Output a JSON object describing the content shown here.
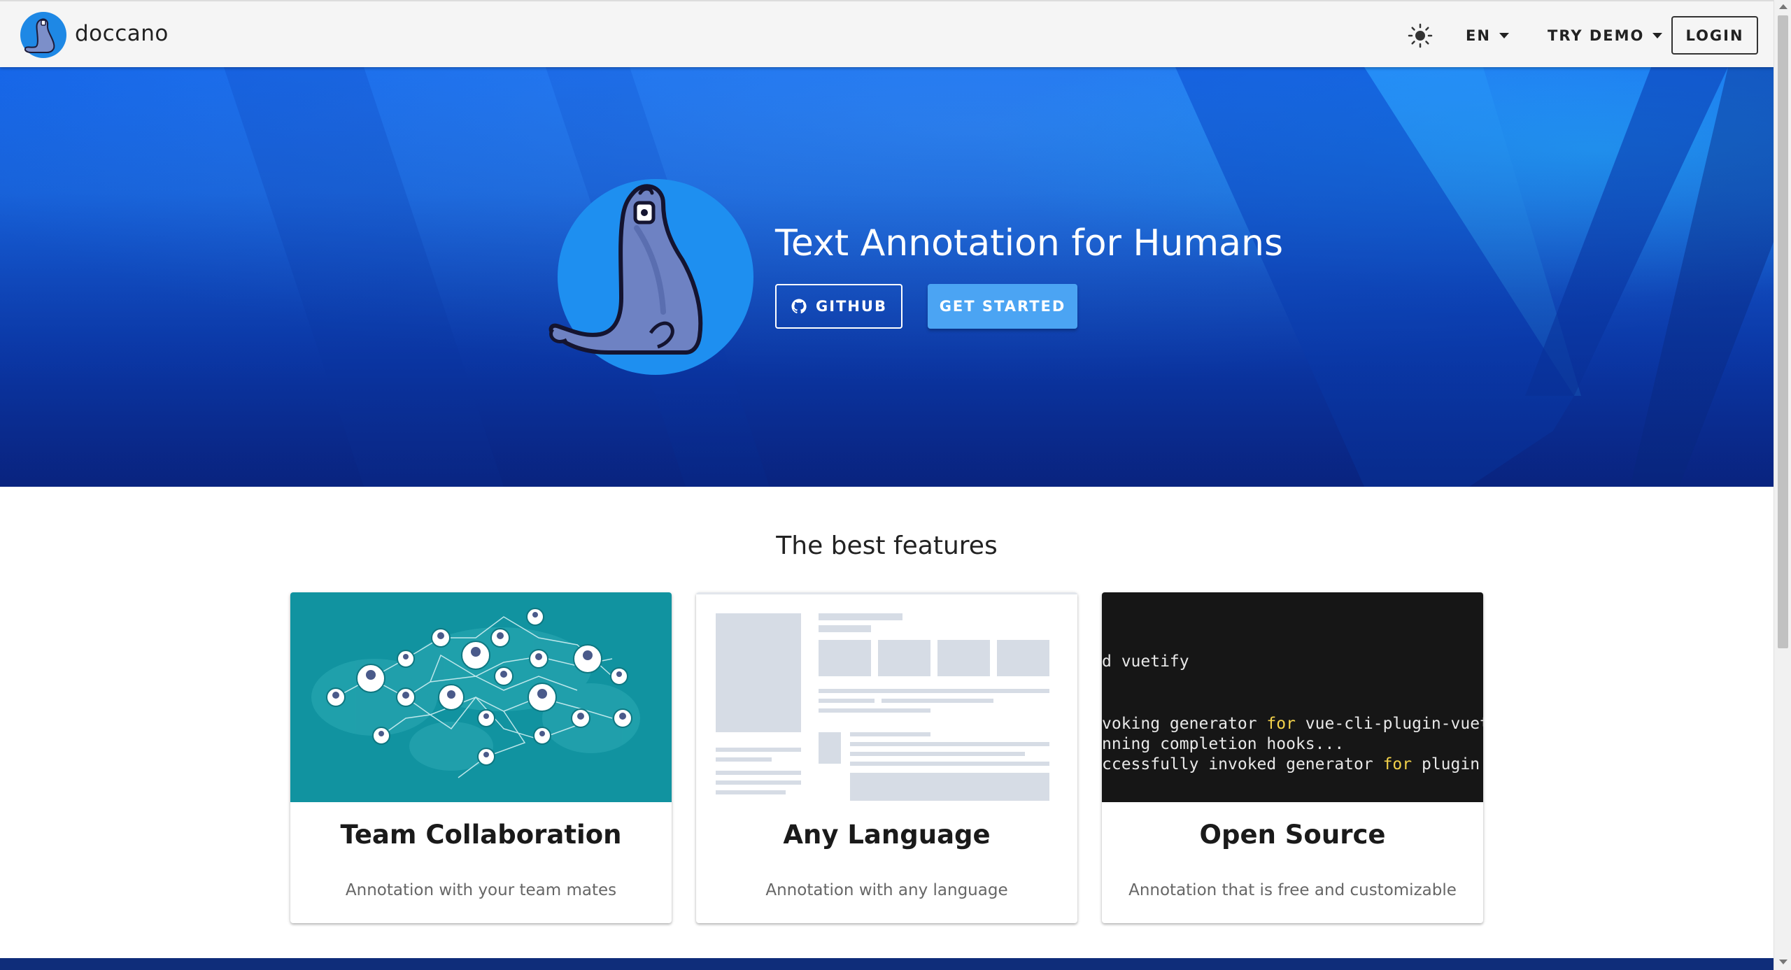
{
  "header": {
    "brand_name": "doccano",
    "lang_label": "EN",
    "demo_label": "TRY DEMO",
    "login_label": "LOGIN"
  },
  "hero": {
    "title": "Text Annotation for Humans",
    "github_label": "GITHUB",
    "get_started_label": "GET STARTED"
  },
  "features": {
    "title": "The best features",
    "cards": [
      {
        "title": "Team Collaboration",
        "text": "Annotation with your team mates"
      },
      {
        "title": "Any Language",
        "text": "Annotation with any language"
      },
      {
        "title": "Open Source",
        "text": "Annotation that is free and customizable",
        "terminal": {
          "line1": "d vuetify",
          "line2_pre": "voking generator ",
          "line2_kw": "for",
          "line2_post": " vue-cli-plugin-vuet",
          "line3": "nning completion hooks...",
          "line4_pre": "ccessfully invoked generator ",
          "line4_kw": "for",
          "line4_post": " plugin"
        }
      }
    ]
  },
  "colors": {
    "hero_blue": "#1a6ff0",
    "button_blue": "#4ba4f3",
    "teal": "#1193a0",
    "terminal_bg": "#161616",
    "keyword_yellow": "#f3d24a"
  },
  "icons": [
    "doccano-seal-logo",
    "brightness-icon",
    "chevron-down-icon",
    "github-icon"
  ]
}
